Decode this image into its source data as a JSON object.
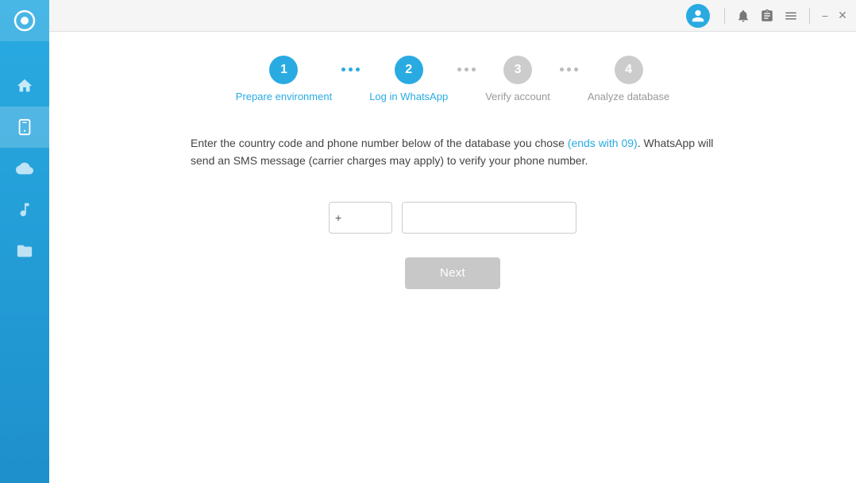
{
  "sidebar": {
    "logo_icon": "circle-dot-icon",
    "nav_items": [
      {
        "id": "home",
        "icon": "home-icon",
        "active": false
      },
      {
        "id": "device",
        "icon": "device-icon",
        "active": true
      },
      {
        "id": "cloud",
        "icon": "cloud-icon",
        "active": false
      },
      {
        "id": "music",
        "icon": "music-icon",
        "active": false
      },
      {
        "id": "folder",
        "icon": "folder-icon",
        "active": false
      }
    ]
  },
  "titlebar": {
    "avatar_icon": "user-avatar-icon",
    "bell_icon": "bell-icon",
    "clipboard_icon": "clipboard-icon",
    "menu_icon": "menu-icon",
    "minimize_icon": "minimize-icon",
    "close_icon": "close-icon"
  },
  "steps": [
    {
      "id": "prepare",
      "number": "1",
      "label": "Prepare environment",
      "state": "completed"
    },
    {
      "id": "login",
      "number": "2",
      "label": "Log in WhatsApp",
      "state": "active"
    },
    {
      "id": "verify",
      "number": "3",
      "label": "Verify account",
      "state": "inactive"
    },
    {
      "id": "analyze",
      "number": "4",
      "label": "Analyze database",
      "state": "inactive"
    }
  ],
  "instruction": {
    "text_before": "Enter the country code and phone number below of the database you chose ",
    "highlight": "(ends with 09)",
    "text_after": ". WhatsApp will send an SMS message (carrier charges may apply) to verify your phone number."
  },
  "inputs": {
    "country_code_placeholder": "",
    "country_code_prefix": "+",
    "phone_placeholder": ""
  },
  "buttons": {
    "next_label": "Next"
  }
}
